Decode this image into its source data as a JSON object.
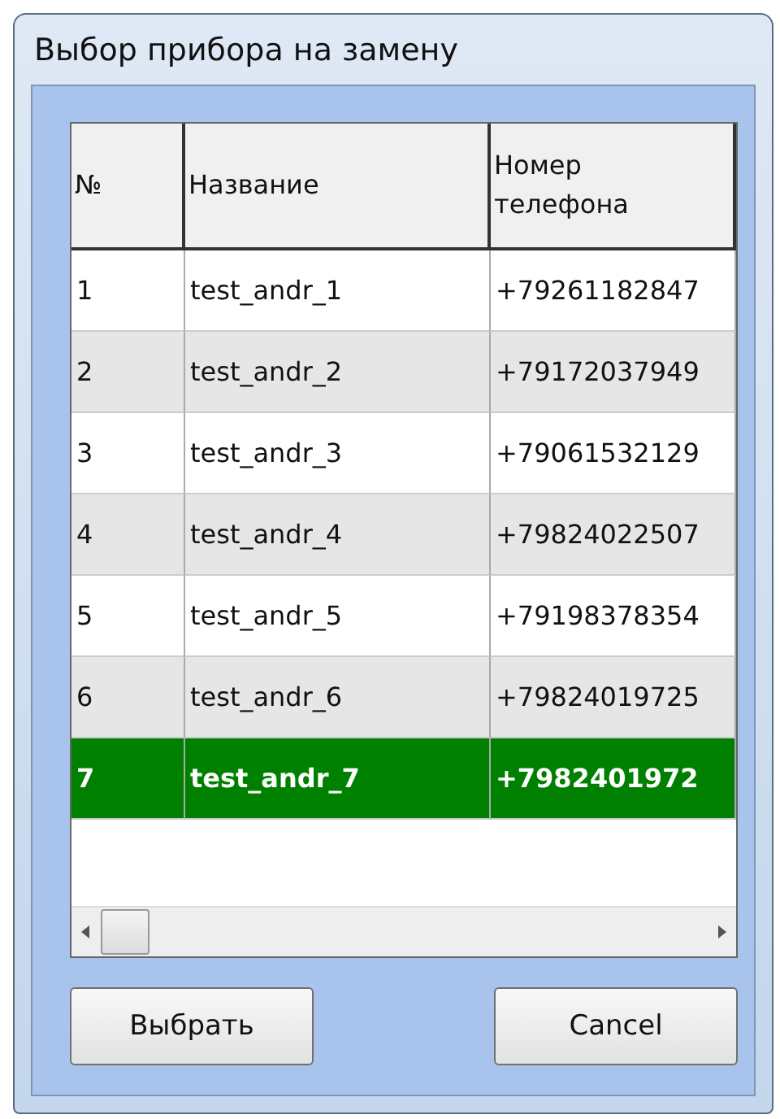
{
  "window": {
    "title": "Выбор прибора на замену"
  },
  "table": {
    "columns": [
      "№",
      "Название",
      "Номер телефона"
    ],
    "rows": [
      {
        "cells": [
          "1",
          "test_andr_1",
          "+79261182847"
        ],
        "selected": false
      },
      {
        "cells": [
          "2",
          "test_andr_2",
          "+79172037949"
        ],
        "selected": false
      },
      {
        "cells": [
          "3",
          "test_andr_3",
          "+79061532129"
        ],
        "selected": false
      },
      {
        "cells": [
          "4",
          "test_andr_4",
          "+79824022507"
        ],
        "selected": false
      },
      {
        "cells": [
          "5",
          "test_andr_5",
          "+79198378354"
        ],
        "selected": false
      },
      {
        "cells": [
          "6",
          "test_andr_6",
          "+79824019725"
        ],
        "selected": false
      },
      {
        "cells": [
          "7",
          "test_andr_7",
          "+7982401972"
        ],
        "selected": true
      }
    ]
  },
  "buttons": [
    "Выбрать",
    "Cancel"
  ]
}
